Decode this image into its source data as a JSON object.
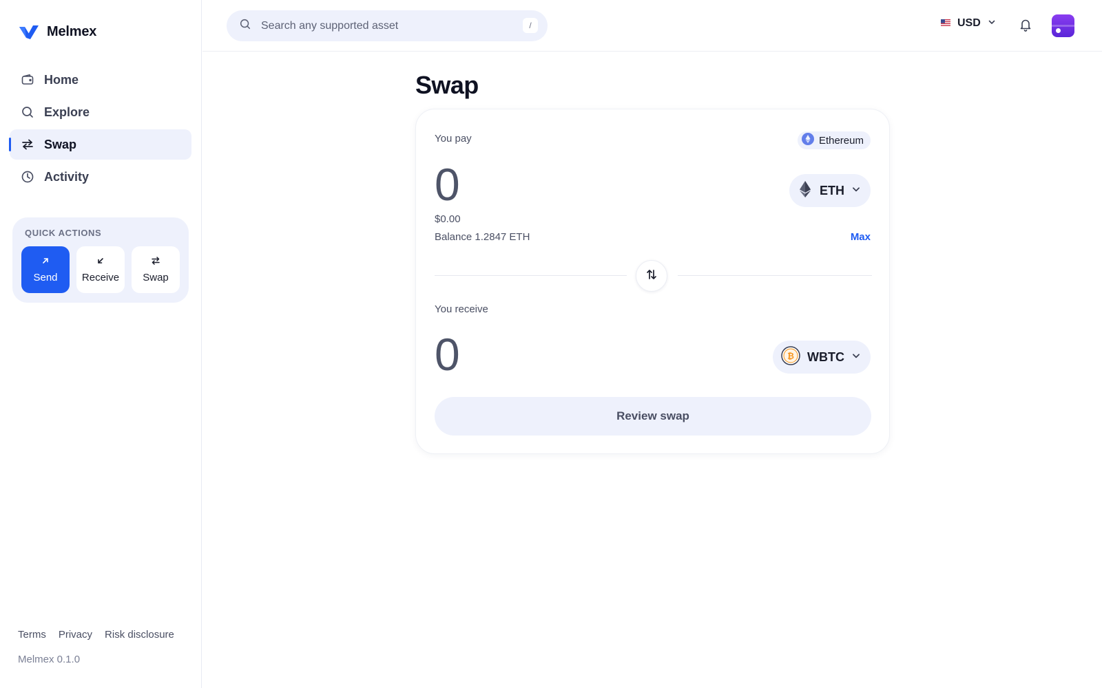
{
  "brand": {
    "name": "Melmex",
    "version": "Melmex 0.1.0"
  },
  "sidebar": {
    "items": [
      {
        "label": "Home",
        "icon": "wallet-icon"
      },
      {
        "label": "Explore",
        "icon": "search-icon"
      },
      {
        "label": "Swap",
        "icon": "swap-arrows-icon",
        "active": true
      },
      {
        "label": "Activity",
        "icon": "clock-icon"
      }
    ],
    "quick_actions": {
      "title": "QUICK ACTIONS",
      "send": "Send",
      "receive": "Receive",
      "swap": "Swap"
    },
    "footer": {
      "terms": "Terms",
      "privacy": "Privacy",
      "risk": "Risk disclosure"
    }
  },
  "topbar": {
    "search_placeholder": "Search any supported asset",
    "search_shortcut": "/",
    "currency": "USD",
    "currency_flag": "us-flag-icon"
  },
  "page": {
    "title": "Swap"
  },
  "swap": {
    "pay": {
      "label": "You pay",
      "network": "Ethereum",
      "amount": "0",
      "fiat": "$0.00",
      "balance": "Balance 1.2847 ETH",
      "max": "Max",
      "token": "ETH"
    },
    "receive": {
      "label": "You receive",
      "amount": "0",
      "token": "WBTC"
    },
    "review_button": "Review swap"
  },
  "colors": {
    "accent": "#1f5cf2",
    "surface": "#eef1fc",
    "avatar": "#6a2fe3",
    "btc": "#f7931a",
    "eth": "#627eea"
  }
}
